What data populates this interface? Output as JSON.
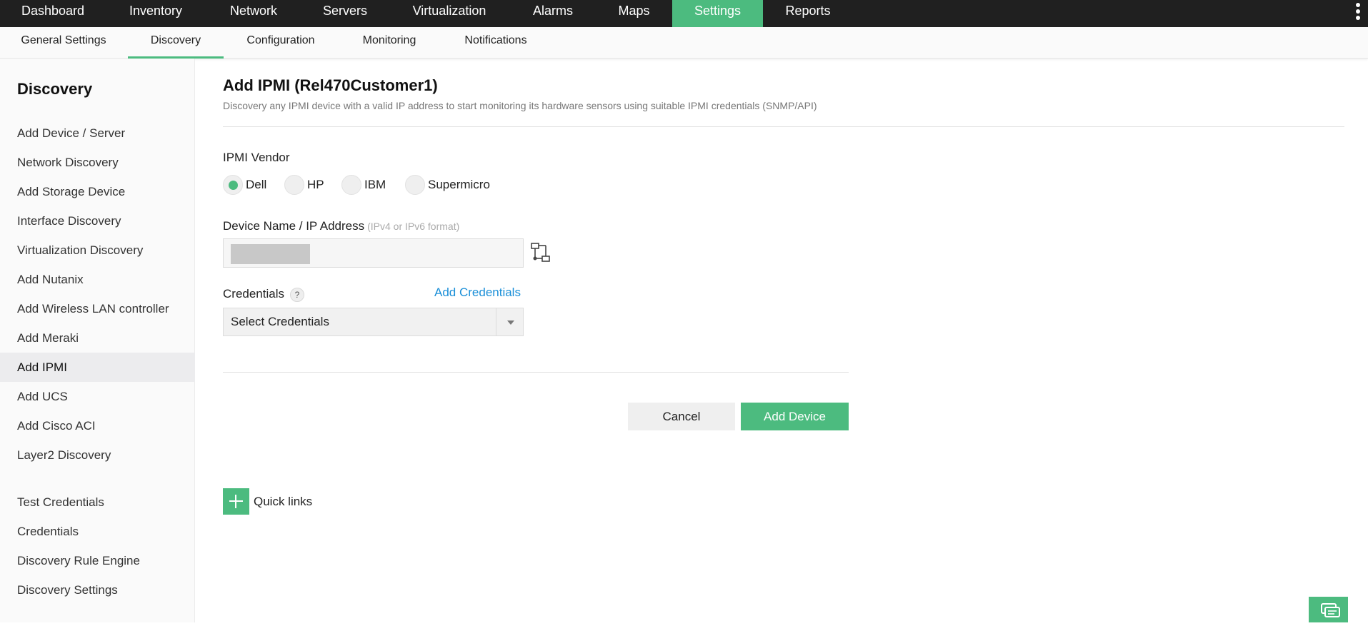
{
  "topnav": {
    "items": [
      {
        "label": "Dashboard"
      },
      {
        "label": "Inventory"
      },
      {
        "label": "Network"
      },
      {
        "label": "Servers"
      },
      {
        "label": "Virtualization"
      },
      {
        "label": "Alarms"
      },
      {
        "label": "Maps"
      },
      {
        "label": "Settings",
        "active": true
      },
      {
        "label": "Reports"
      }
    ]
  },
  "subnav": {
    "items": [
      {
        "label": "General Settings"
      },
      {
        "label": "Discovery",
        "active": true
      },
      {
        "label": "Configuration"
      },
      {
        "label": "Monitoring"
      },
      {
        "label": "Notifications"
      }
    ]
  },
  "sidebar": {
    "title": "Discovery",
    "items": [
      {
        "label": "Add Device / Server"
      },
      {
        "label": "Network Discovery"
      },
      {
        "label": "Add Storage Device"
      },
      {
        "label": "Interface Discovery"
      },
      {
        "label": "Virtualization Discovery"
      },
      {
        "label": "Add Nutanix"
      },
      {
        "label": "Add Wireless LAN controller"
      },
      {
        "label": "Add Meraki"
      },
      {
        "label": "Add IPMI",
        "active": true
      },
      {
        "label": "Add UCS"
      },
      {
        "label": "Add Cisco ACI"
      },
      {
        "label": "Layer2 Discovery"
      },
      {
        "label": "Test Credentials"
      },
      {
        "label": "Credentials"
      },
      {
        "label": "Discovery Rule Engine"
      },
      {
        "label": "Discovery Settings"
      }
    ]
  },
  "main": {
    "title": "Add IPMI (Rel470Customer1)",
    "description": "Discovery any IPMI device with a valid IP address to start monitoring its hardware sensors using suitable IPMI credentials (SNMP/API)",
    "vendor": {
      "label": "IPMI Vendor",
      "options": [
        "Dell",
        "HP",
        "IBM",
        "Supermicro"
      ],
      "selected": "Dell"
    },
    "device": {
      "label": "Device Name / IP Address",
      "hint": "(IPv4 or IPv6 format)"
    },
    "credentials": {
      "label": "Credentials",
      "help": "?",
      "add_link": "Add Credentials",
      "select_value": "Select Credentials"
    },
    "buttons": {
      "cancel": "Cancel",
      "add": "Add Device"
    },
    "quick_links": "Quick links"
  },
  "colors": {
    "accent": "#4cbb7f",
    "topnav_bg": "#202020",
    "link": "#1a8fd8"
  }
}
